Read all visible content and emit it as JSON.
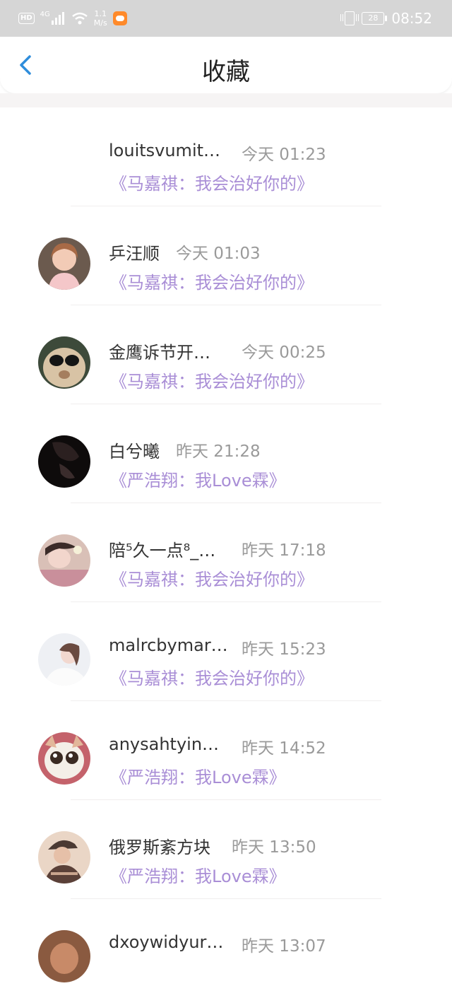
{
  "status_bar": {
    "hd": "HD",
    "network": "4G",
    "speed_value": "1.1",
    "speed_unit": "M/s",
    "battery": "28",
    "time": "08:52"
  },
  "header": {
    "title": "收藏",
    "back_icon": "chevron-left-icon",
    "accent_color": "#2f8ddb"
  },
  "colors": {
    "work_title": "#a98ed6",
    "time": "#9a9a9a"
  },
  "items": [
    {
      "name": "louitsvumit…",
      "time": "今天 01:23",
      "work": "《马嘉祺：我会治好你的》",
      "avatar": "none"
    },
    {
      "name": "乒汪顺",
      "time": "今天 01:03",
      "work": "《马嘉祺：我会治好你的》",
      "avatar": "girl-portrait"
    },
    {
      "name": "金鹰诉节开…",
      "time": "今天 00:25",
      "work": "《马嘉祺：我会治好你的》",
      "avatar": "alpaca-sunglasses"
    },
    {
      "name": "白兮曦",
      "time": "昨天 21:28",
      "work": "《严浩翔：我Love霖》",
      "avatar": "dark-portrait"
    },
    {
      "name": "陪⁵久一点⁸_…",
      "time": "昨天 17:18",
      "work": "《马嘉祺：我会治好你的》",
      "avatar": "girl-lying"
    },
    {
      "name": "malrcbymar…",
      "time": "昨天 15:23",
      "work": "《马嘉祺：我会治好你的》",
      "avatar": "girl-white"
    },
    {
      "name": "anysahtyin…",
      "time": "昨天 14:52",
      "work": "《严浩翔：我Love霖》",
      "avatar": "cat-big-eyes"
    },
    {
      "name": "俄罗斯紊方块",
      "time": "昨天 13:50",
      "work": "《严浩翔：我Love霖》",
      "avatar": "boy-hat"
    },
    {
      "name": "dxoywidyur…",
      "time": "昨天 13:07",
      "work": "",
      "avatar": "brown-portrait"
    }
  ]
}
